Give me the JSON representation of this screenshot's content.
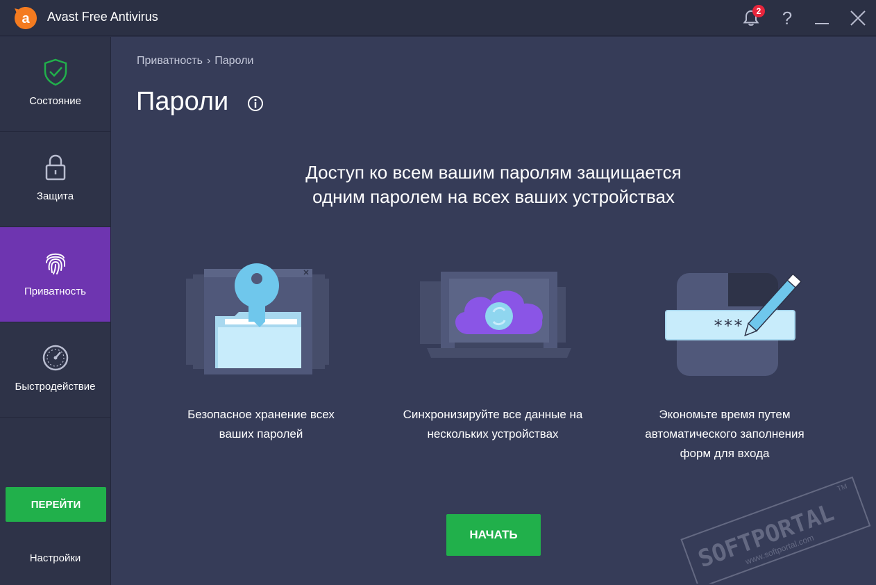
{
  "app": {
    "title": "Avast Free Antivirus",
    "notification_count": "2"
  },
  "titlebar": {
    "help_label": "?"
  },
  "sidebar": {
    "items": [
      {
        "label": "Состояние"
      },
      {
        "label": "Защита"
      },
      {
        "label": "Приватность"
      },
      {
        "label": "Быстродействие"
      }
    ],
    "go_button": "ПЕРЕЙТИ",
    "settings": "Настройки"
  },
  "breadcrumb": {
    "parent": "Приватность",
    "separator": "›",
    "current": "Пароли"
  },
  "page": {
    "title": "Пароли",
    "headline_line1": "Доступ ко всем вашим паролям защищается",
    "headline_line2": "одним паролем на всех ваших устройствах",
    "features": [
      {
        "line1": "Безопасное хранение всех",
        "line2": "ваших паролей",
        "line3": ""
      },
      {
        "line1": "Синхронизируйте все данные на",
        "line2": "нескольких устройствах",
        "line3": ""
      },
      {
        "line1": "Экономьте время путем",
        "line2": "автоматического заполнения",
        "line3": "форм для входа"
      }
    ],
    "password_mask": "***",
    "start_button": "НАЧАТЬ"
  },
  "watermark": {
    "text": "SOFTPORTAL",
    "url": "www.softportal.com",
    "tm": "TM"
  },
  "colors": {
    "accent_green": "#21b04b",
    "active_purple": "#6e35b0",
    "brand_orange": "#f47b20",
    "badge_red": "#e8253c"
  }
}
